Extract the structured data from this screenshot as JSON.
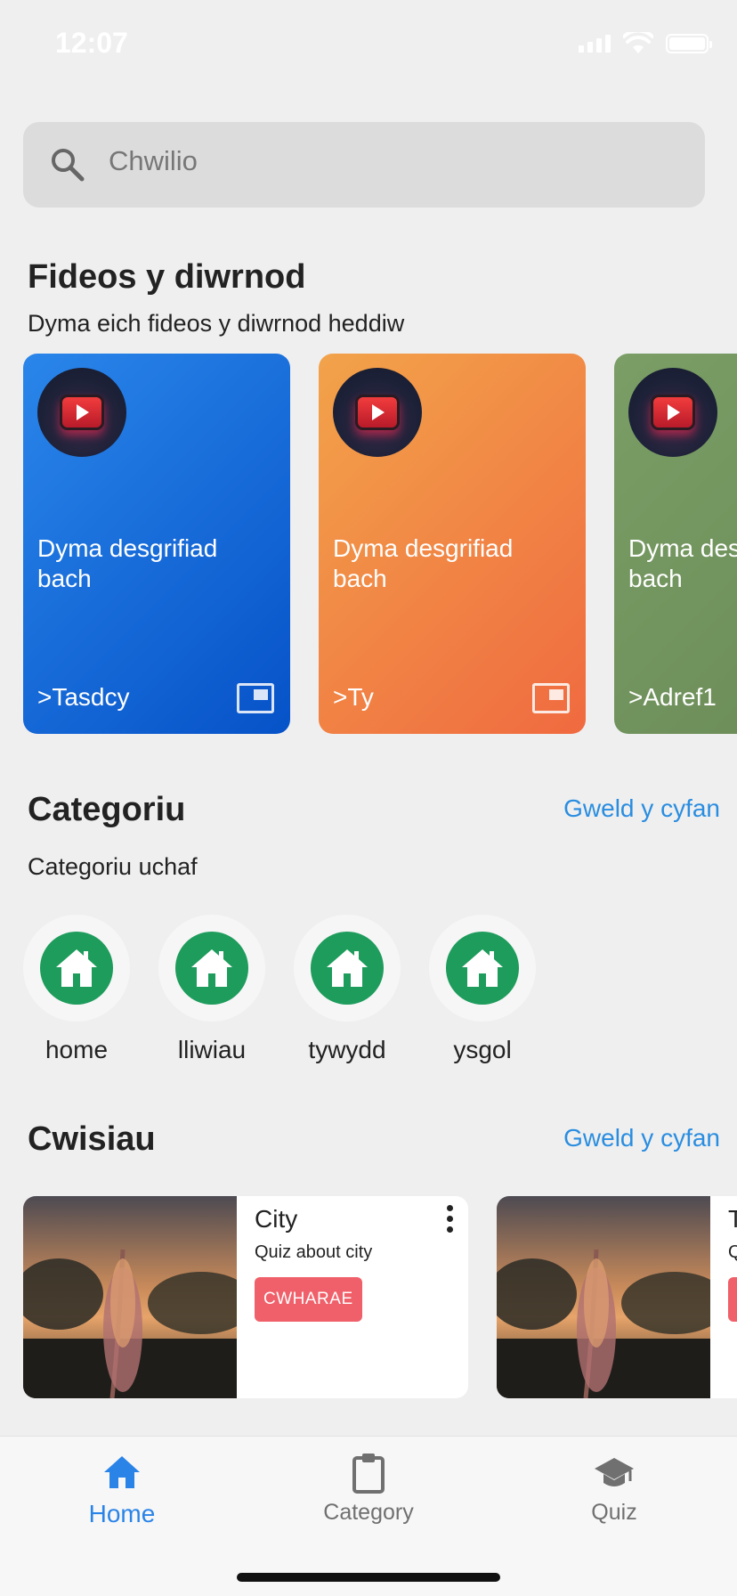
{
  "status_bar": {
    "time": "12:07"
  },
  "search": {
    "placeholder": "Chwilio"
  },
  "videos_section": {
    "title": "Fideos y diwrnod",
    "subtitle": "Dyma eich fideos y diwrnod heddiw",
    "cards": [
      {
        "description": "Dyma desgrifiad bach",
        "tag": ">Tasdcy",
        "gradient": [
          "#2a86ea",
          "#0652c8"
        ]
      },
      {
        "description": "Dyma desgrifiad bach",
        "tag": ">Ty",
        "gradient": [
          "#f2a34a",
          "#f06a40"
        ]
      },
      {
        "description": "Dyma desgrifiad bach",
        "tag": ">Adref1",
        "gradient": [
          "#7a9e66",
          "#6a8a56"
        ]
      }
    ]
  },
  "categories_section": {
    "title": "Categoriu",
    "see_all": "Gweld y cyfan",
    "subtitle": "Categoriu uchaf",
    "items": [
      {
        "label": "home",
        "icon": "house-icon"
      },
      {
        "label": "lliwiau",
        "icon": "house-icon"
      },
      {
        "label": "tywydd",
        "icon": "house-icon"
      },
      {
        "label": "ysgol",
        "icon": "house-icon"
      }
    ]
  },
  "quiz_section": {
    "title": "Cwisiau",
    "see_all": "Gweld y cyfan",
    "cards": [
      {
        "title": "City",
        "description": "Quiz about city",
        "button": "CWHARAE"
      },
      {
        "title": "T",
        "description": "Q",
        "button": ""
      }
    ]
  },
  "bottom_nav": {
    "items": [
      {
        "label": "Home",
        "icon": "home-icon",
        "active": true
      },
      {
        "label": "Category",
        "icon": "clipboard-icon",
        "active": false
      },
      {
        "label": "Quiz",
        "icon": "graduation-cap-icon",
        "active": false
      }
    ]
  },
  "colors": {
    "accent": "#2a84e8",
    "category_green": "#1e9c5c",
    "play_button": "#f0606a"
  }
}
